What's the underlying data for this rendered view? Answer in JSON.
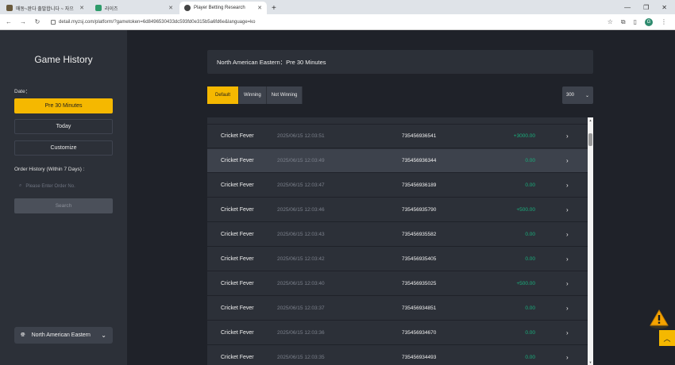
{
  "browser": {
    "tabs": [
      {
        "title": "매동~완다 출발합니다 ~ 자으",
        "favicon_color": "#6a5a3c"
      },
      {
        "title": "라이즈",
        "favicon_color": "#2e9b6a"
      },
      {
        "title": "Player Betting Research",
        "favicon_color": "#444444",
        "active": true
      }
    ],
    "url": "detail.myzsj.com/platform/?gametoken=6d8496530433dc593fd0e315b5a6fd6e&language=ko",
    "profile_initial": "G"
  },
  "sidebar": {
    "title": "Game History",
    "date_label": "Date：",
    "date_options": [
      "Pre 30 Minutes",
      "Today",
      "Customize"
    ],
    "order_history_label": "Order History (Within 7 Days) :",
    "order_input_placeholder": "Please Enter Order No.",
    "search_label": "Search",
    "region_label": "North American Eastern"
  },
  "main": {
    "header": "North American Eastern：Pre 30 Minutes",
    "filters": [
      "Default",
      "Winning",
      "Not Winning"
    ],
    "page_size": "300",
    "rows": [
      {
        "game": "Cricket Fever",
        "time": "2025/06/15 12:03:51",
        "order": "735456936541",
        "amount": "+3000.00"
      },
      {
        "game": "Cricket Fever",
        "time": "2025/06/15 12:03:49",
        "order": "735456936344",
        "amount": "0.00",
        "highlight": true
      },
      {
        "game": "Cricket Fever",
        "time": "2025/06/15 12:03:47",
        "order": "735456936189",
        "amount": "0.00"
      },
      {
        "game": "Cricket Fever",
        "time": "2025/06/15 12:03:46",
        "order": "735456935790",
        "amount": "+500.00"
      },
      {
        "game": "Cricket Fever",
        "time": "2025/06/15 12:03:43",
        "order": "735456935582",
        "amount": "0.00"
      },
      {
        "game": "Cricket Fever",
        "time": "2025/06/15 12:03:42",
        "order": "735456935405",
        "amount": "0.00"
      },
      {
        "game": "Cricket Fever",
        "time": "2025/06/15 12:03:40",
        "order": "735456935025",
        "amount": "+500.00"
      },
      {
        "game": "Cricket Fever",
        "time": "2025/06/15 12:03:37",
        "order": "735456934851",
        "amount": "0.00"
      },
      {
        "game": "Cricket Fever",
        "time": "2025/06/15 12:03:36",
        "order": "735456934670",
        "amount": "0.00"
      },
      {
        "game": "Cricket Fever",
        "time": "2025/06/15 12:03:35",
        "order": "735456934493",
        "amount": "0.00"
      }
    ]
  },
  "colors": {
    "accent": "#f5b800",
    "positive": "#19b17d",
    "panel": "#2c3038",
    "background": "#1f2229"
  }
}
